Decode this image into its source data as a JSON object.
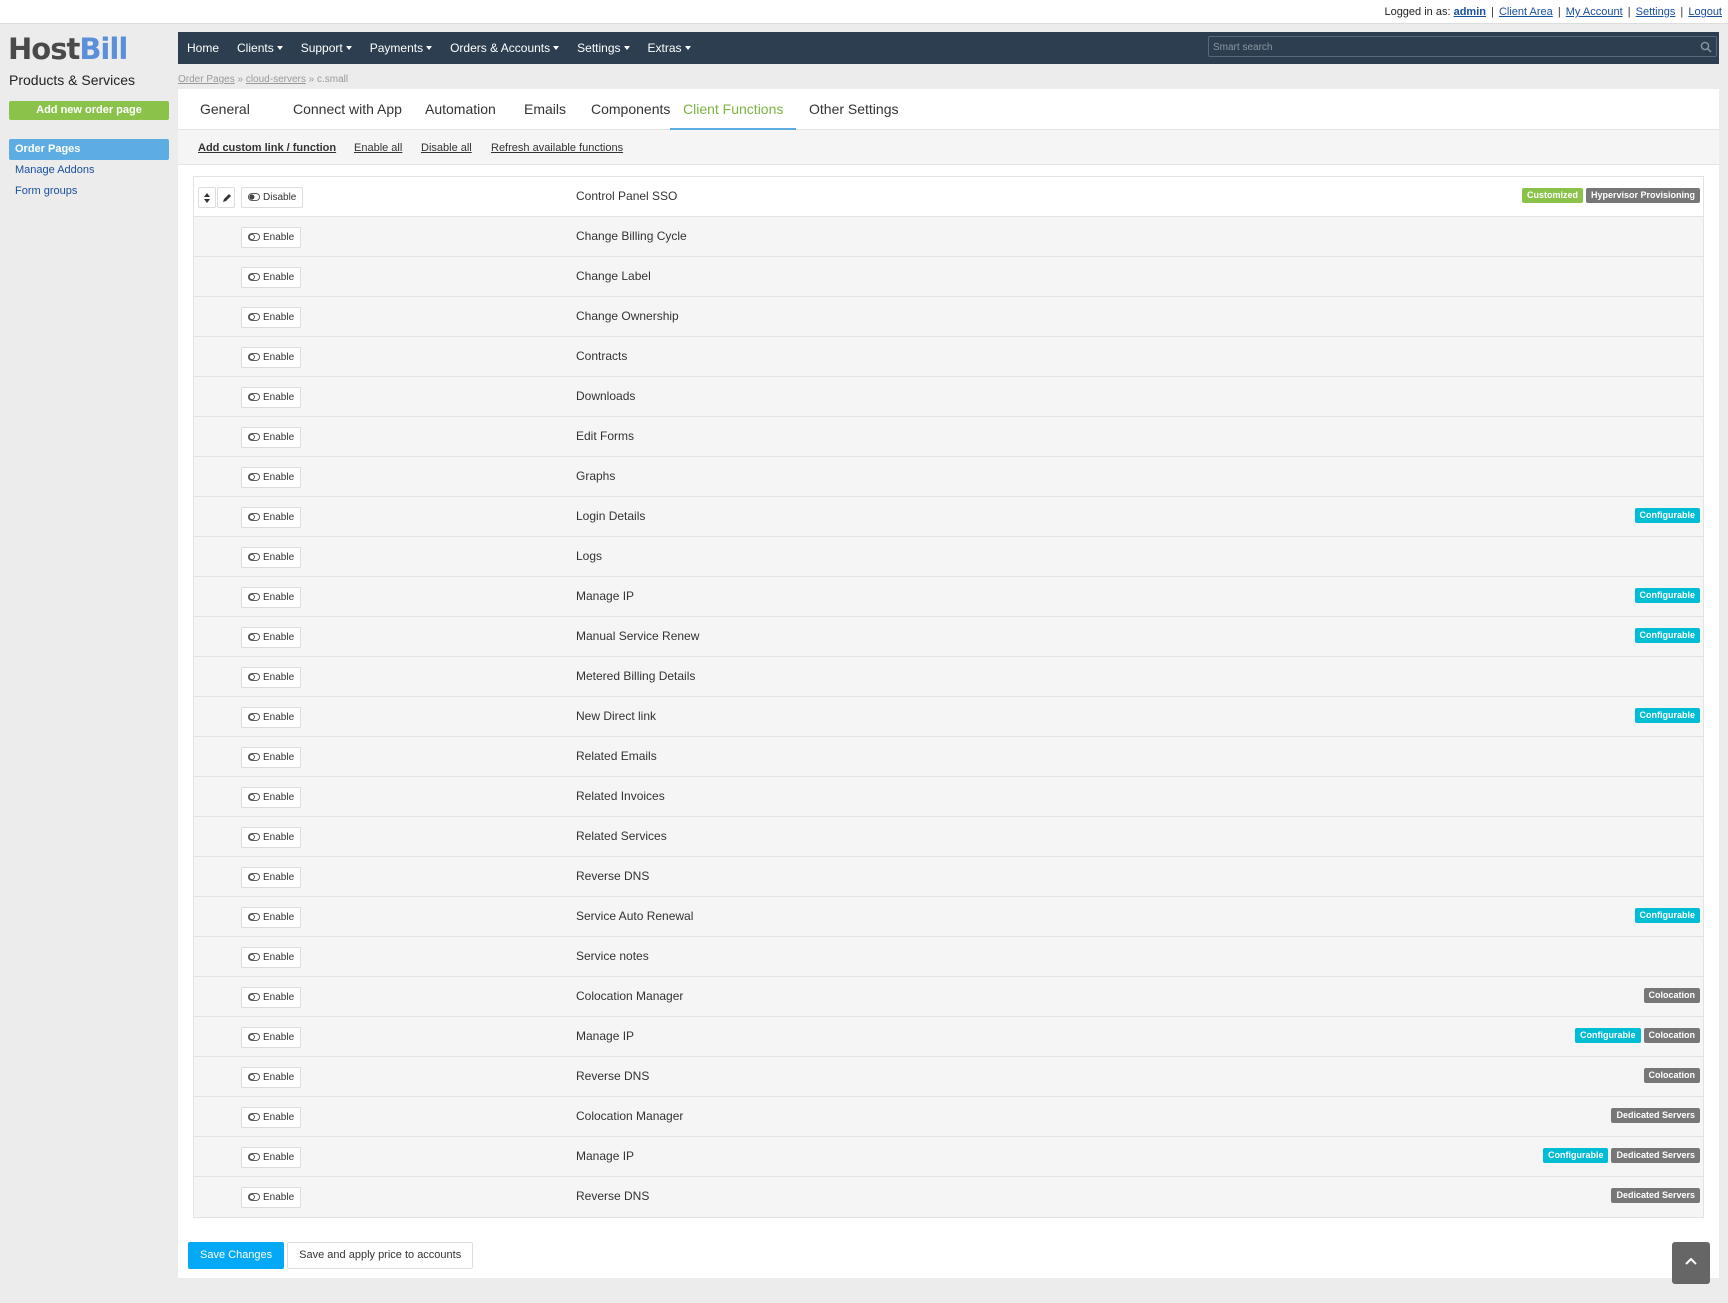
{
  "topbar": {
    "logged_in_label": "Logged in as:",
    "user": "admin",
    "links": [
      "Client Area",
      "My Account",
      "Settings",
      "Logout"
    ]
  },
  "sidebar": {
    "logo_host": "Host",
    "logo_bill": "Bill",
    "section_title": "Products & Services",
    "add_button": "Add new order page",
    "items": [
      "Order Pages",
      "Manage Addons",
      "Form groups"
    ]
  },
  "navbar": {
    "items": [
      "Home",
      "Clients",
      "Support",
      "Payments",
      "Orders & Accounts",
      "Settings",
      "Extras"
    ],
    "search_placeholder": "Smart search"
  },
  "breadcrumb": [
    "Order Pages",
    "cloud-servers",
    "c.small"
  ],
  "tabs": [
    "General",
    "Connect with App",
    "Automation",
    "Emails",
    "Components",
    "Client Functions",
    "Other Settings"
  ],
  "active_tab": "Client Functions",
  "subactions": [
    "Add custom link / function",
    "Enable all",
    "Disable all",
    "Refresh available functions"
  ],
  "functions": [
    {
      "name": "Control Panel SSO",
      "toggle": "Disable",
      "badges": [
        {
          "text": "Customized",
          "color": "green"
        },
        {
          "text": "Hypervisor Provisioning",
          "color": "gray"
        }
      ]
    },
    {
      "name": "Change Billing Cycle",
      "toggle": "Enable",
      "badges": []
    },
    {
      "name": "Change Label",
      "toggle": "Enable",
      "badges": []
    },
    {
      "name": "Change Ownership",
      "toggle": "Enable",
      "badges": []
    },
    {
      "name": "Contracts",
      "toggle": "Enable",
      "badges": []
    },
    {
      "name": "Downloads",
      "toggle": "Enable",
      "badges": []
    },
    {
      "name": "Edit Forms",
      "toggle": "Enable",
      "badges": []
    },
    {
      "name": "Graphs",
      "toggle": "Enable",
      "badges": []
    },
    {
      "name": "Login Details",
      "toggle": "Enable",
      "badges": [
        {
          "text": "Configurable",
          "color": "cyan"
        }
      ]
    },
    {
      "name": "Logs",
      "toggle": "Enable",
      "badges": []
    },
    {
      "name": "Manage IP",
      "toggle": "Enable",
      "badges": [
        {
          "text": "Configurable",
          "color": "cyan"
        }
      ]
    },
    {
      "name": "Manual Service Renew",
      "toggle": "Enable",
      "badges": [
        {
          "text": "Configurable",
          "color": "cyan"
        }
      ]
    },
    {
      "name": "Metered Billing Details",
      "toggle": "Enable",
      "badges": []
    },
    {
      "name": "New Direct link",
      "toggle": "Enable",
      "badges": [
        {
          "text": "Configurable",
          "color": "cyan"
        }
      ]
    },
    {
      "name": "Related Emails",
      "toggle": "Enable",
      "badges": []
    },
    {
      "name": "Related Invoices",
      "toggle": "Enable",
      "badges": []
    },
    {
      "name": "Related Services",
      "toggle": "Enable",
      "badges": []
    },
    {
      "name": "Reverse DNS",
      "toggle": "Enable",
      "badges": []
    },
    {
      "name": "Service Auto Renewal",
      "toggle": "Enable",
      "badges": [
        {
          "text": "Configurable",
          "color": "cyan"
        }
      ]
    },
    {
      "name": "Service notes",
      "toggle": "Enable",
      "badges": []
    },
    {
      "name": "Colocation Manager",
      "toggle": "Enable",
      "badges": [
        {
          "text": "Colocation",
          "color": "gray"
        }
      ]
    },
    {
      "name": "Manage IP",
      "toggle": "Enable",
      "badges": [
        {
          "text": "Configurable",
          "color": "cyan"
        },
        {
          "text": "Colocation",
          "color": "gray"
        }
      ]
    },
    {
      "name": "Reverse DNS",
      "toggle": "Enable",
      "badges": [
        {
          "text": "Colocation",
          "color": "gray"
        }
      ]
    },
    {
      "name": "Colocation Manager",
      "toggle": "Enable",
      "badges": [
        {
          "text": "Dedicated Servers",
          "color": "gray"
        }
      ]
    },
    {
      "name": "Manage IP",
      "toggle": "Enable",
      "badges": [
        {
          "text": "Configurable",
          "color": "cyan"
        },
        {
          "text": "Dedicated Servers",
          "color": "gray"
        }
      ]
    },
    {
      "name": "Reverse DNS",
      "toggle": "Enable",
      "badges": [
        {
          "text": "Dedicated Servers",
          "color": "gray"
        }
      ]
    }
  ],
  "footer": {
    "save": "Save Changes",
    "apply": "Save and apply price to accounts"
  },
  "colors": {
    "navbar": "#2c3e50",
    "accent_green": "#8bc34a",
    "accent_blue": "#03a9f4",
    "badge_cyan": "#00bcd4",
    "badge_gray": "#777777"
  }
}
